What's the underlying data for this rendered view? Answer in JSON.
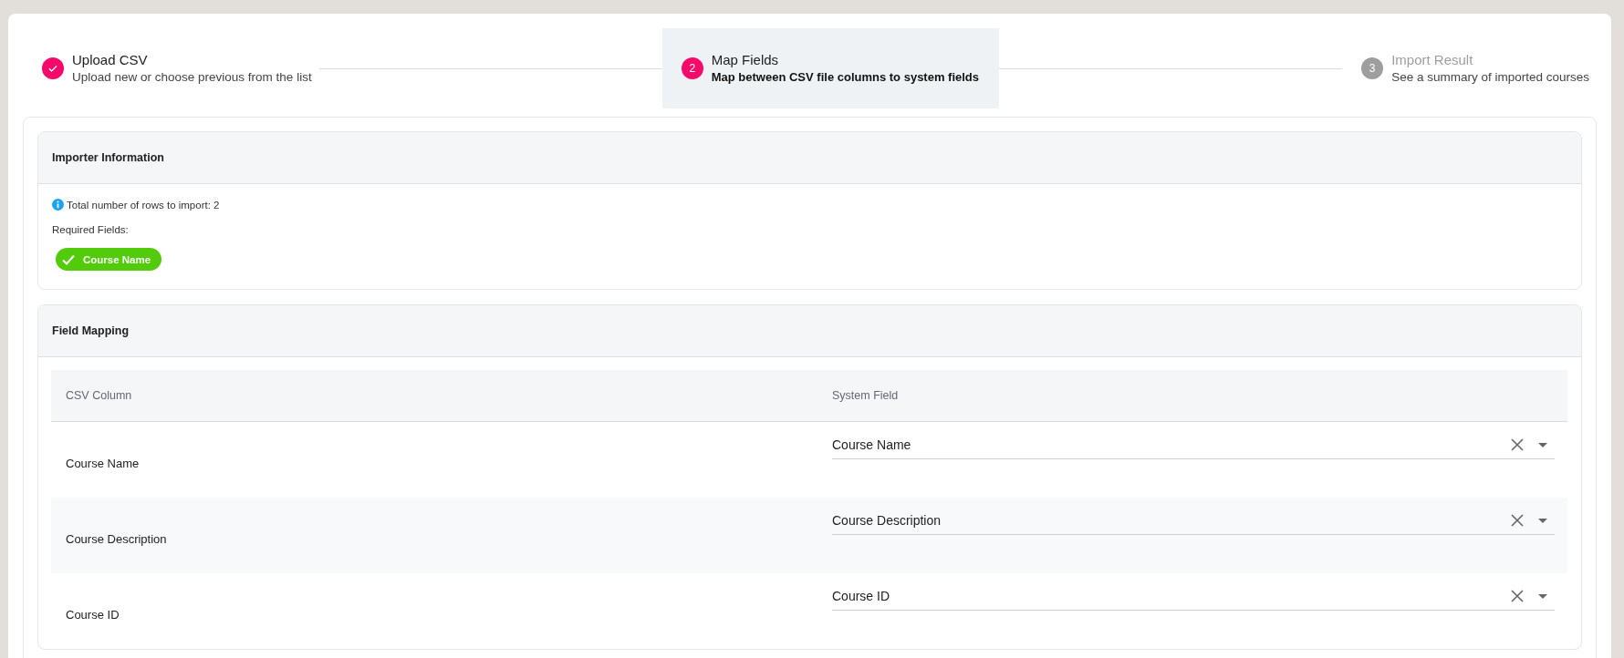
{
  "stepper": [
    {
      "title": "Upload CSV",
      "subtitle": "Upload new or choose previous from the list",
      "completed": true,
      "selected": false
    },
    {
      "number": "2",
      "title": "Map Fields",
      "subtitle": "Map between CSV file columns to system fields",
      "completed": false,
      "selected": true
    },
    {
      "number": "3",
      "title": "Import Result",
      "subtitle": "See a summary of imported courses",
      "completed": false,
      "selected": false
    }
  ],
  "importer_information": {
    "title": "Importer Information",
    "total_rows": "Total number of rows to import: 2",
    "required_label": "Required Fields:",
    "required_fields": [
      {
        "label": "Course Name",
        "satisfied": true
      }
    ]
  },
  "field_mapping": {
    "title": "Field Mapping",
    "columns": [
      "CSV Column",
      "System Field"
    ],
    "rows": [
      {
        "csv_column": "Course Name",
        "system_field": "Course Name"
      },
      {
        "csv_column": "Course Description",
        "system_field": "Course Description"
      },
      {
        "csv_column": "Course ID",
        "system_field": "Course ID"
      }
    ]
  }
}
